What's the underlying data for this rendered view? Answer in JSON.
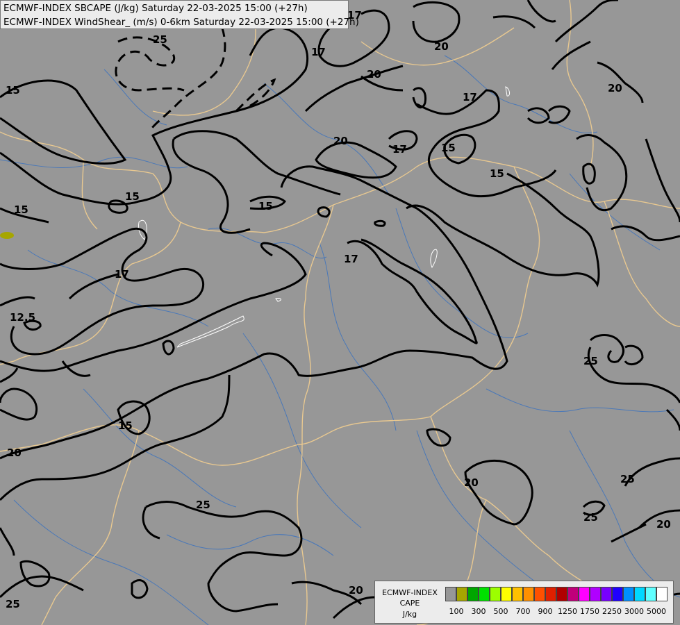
{
  "header": {
    "line1": "ECMWF-INDEX SBCAPE (J/kg) Saturday 22-03-2025 15:00 (+27h)",
    "line2": "ECMWF-INDEX WindShear_ (m/s) 0-6km Saturday 22-03-2025 15:00 (+27h)"
  },
  "legend": {
    "title_line1": "ECMWF-INDEX",
    "title_line2": "CAPE",
    "unit": "J/kg",
    "colors": [
      "#979797",
      "#a6a600",
      "#00a600",
      "#00e000",
      "#9cff00",
      "#ffff00",
      "#ffc000",
      "#ff9000",
      "#ff5000",
      "#e02000",
      "#b00000",
      "#c0007a",
      "#ff00ff",
      "#b000ff",
      "#7800ff",
      "#2000ff",
      "#0090ff",
      "#00d8ff",
      "#60ffff",
      "#ffffff"
    ],
    "tick_labels": [
      "100",
      "300",
      "500",
      "700",
      "900",
      "1250",
      "1750",
      "2250",
      "3000",
      "5000"
    ]
  },
  "map": {
    "background": "#979797",
    "contour_labels": [
      "15",
      "17",
      "20",
      "25",
      "12.5"
    ]
  }
}
